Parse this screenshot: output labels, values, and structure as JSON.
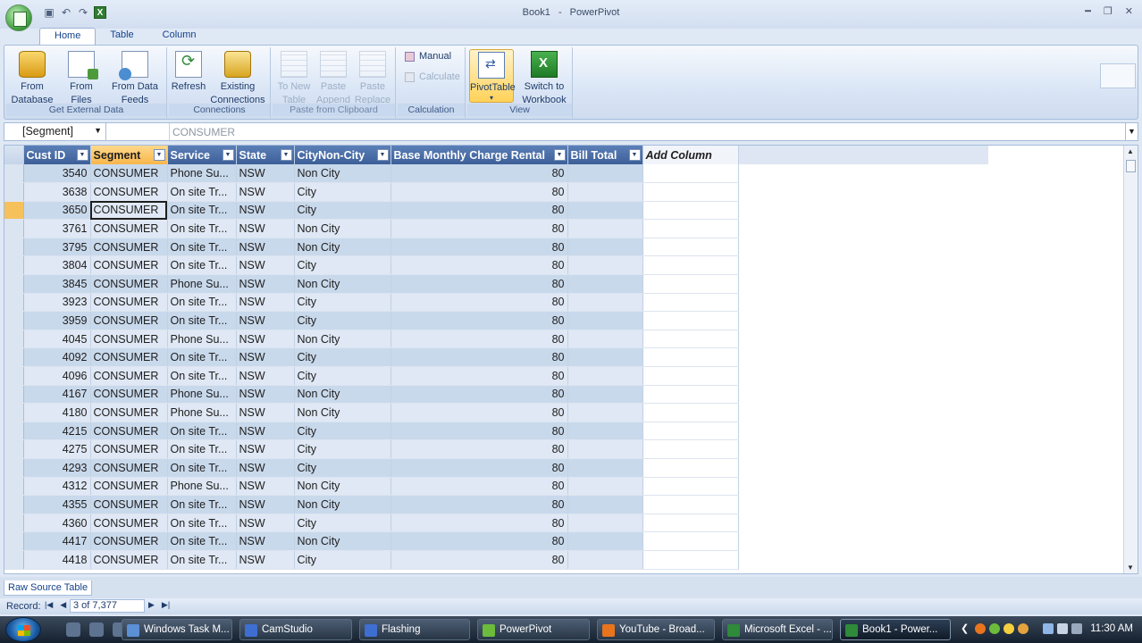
{
  "window": {
    "title": "Book1",
    "app_name": "PowerPivot"
  },
  "ribbon": {
    "tabs": [
      "Home",
      "Table",
      "Column"
    ],
    "active_tab": "Home",
    "groups": {
      "get_external_data": {
        "label": "Get External Data",
        "from_database": [
          "From",
          "Database"
        ],
        "from_files": [
          "From",
          "Files"
        ],
        "from_data_feeds": [
          "From Data",
          "Feeds"
        ]
      },
      "connections": {
        "label": "Connections",
        "refresh": "Refresh",
        "existing_connections": [
          "Existing",
          "Connections"
        ]
      },
      "paste_from_clipboard": {
        "label": "Paste from Clipboard",
        "to_new_table": [
          "To New",
          "Table"
        ],
        "paste_append": [
          "Paste",
          "Append"
        ],
        "paste_replace": [
          "Paste",
          "Replace"
        ]
      },
      "calculation": {
        "label": "Calculation",
        "manual": "Manual",
        "calculate": "Calculate"
      },
      "view": {
        "label": "View",
        "pivot_table": "PivotTable",
        "switch_to_workbook": [
          "Switch to",
          "Workbook"
        ]
      }
    }
  },
  "formula_bar": {
    "name_box": "[Segment]",
    "value": "CONSUMER"
  },
  "grid": {
    "columns": [
      "Cust ID",
      "Segment",
      "Service",
      "State",
      "CityNon-City",
      "Base Monthly Charge Rental",
      "Bill Total"
    ],
    "add_column": "Add Column",
    "selected_column": "Segment",
    "current_row_index": 2,
    "rows": [
      [
        "3540",
        "CONSUMER",
        "Phone Su...",
        "NSW",
        "Non City",
        "80",
        ""
      ],
      [
        "3638",
        "CONSUMER",
        "On site Tr...",
        "NSW",
        "City",
        "80",
        ""
      ],
      [
        "3650",
        "CONSUMER",
        "On site Tr...",
        "NSW",
        "City",
        "80",
        ""
      ],
      [
        "3761",
        "CONSUMER",
        "On site Tr...",
        "NSW",
        "Non City",
        "80",
        ""
      ],
      [
        "3795",
        "CONSUMER",
        "On site Tr...",
        "NSW",
        "Non City",
        "80",
        ""
      ],
      [
        "3804",
        "CONSUMER",
        "On site Tr...",
        "NSW",
        "City",
        "80",
        ""
      ],
      [
        "3845",
        "CONSUMER",
        "Phone Su...",
        "NSW",
        "Non City",
        "80",
        ""
      ],
      [
        "3923",
        "CONSUMER",
        "On site Tr...",
        "NSW",
        "City",
        "80",
        ""
      ],
      [
        "3959",
        "CONSUMER",
        "On site Tr...",
        "NSW",
        "City",
        "80",
        ""
      ],
      [
        "4045",
        "CONSUMER",
        "Phone Su...",
        "NSW",
        "Non City",
        "80",
        ""
      ],
      [
        "4092",
        "CONSUMER",
        "On site Tr...",
        "NSW",
        "City",
        "80",
        ""
      ],
      [
        "4096",
        "CONSUMER",
        "On site Tr...",
        "NSW",
        "City",
        "80",
        ""
      ],
      [
        "4167",
        "CONSUMER",
        "Phone Su...",
        "NSW",
        "Non City",
        "80",
        ""
      ],
      [
        "4180",
        "CONSUMER",
        "Phone Su...",
        "NSW",
        "Non City",
        "80",
        ""
      ],
      [
        "4215",
        "CONSUMER",
        "On site Tr...",
        "NSW",
        "City",
        "80",
        ""
      ],
      [
        "4275",
        "CONSUMER",
        "On site Tr...",
        "NSW",
        "City",
        "80",
        ""
      ],
      [
        "4293",
        "CONSUMER",
        "On site Tr...",
        "NSW",
        "City",
        "80",
        ""
      ],
      [
        "4312",
        "CONSUMER",
        "Phone Su...",
        "NSW",
        "Non City",
        "80",
        ""
      ],
      [
        "4355",
        "CONSUMER",
        "On site Tr...",
        "NSW",
        "Non City",
        "80",
        ""
      ],
      [
        "4360",
        "CONSUMER",
        "On site Tr...",
        "NSW",
        "City",
        "80",
        ""
      ],
      [
        "4417",
        "CONSUMER",
        "On site Tr...",
        "NSW",
        "Non City",
        "80",
        ""
      ],
      [
        "4418",
        "CONSUMER",
        "On site Tr...",
        "NSW",
        "City",
        "80",
        ""
      ]
    ]
  },
  "sheet_tab": "Raw Source Table",
  "status": {
    "record_label": "Record:",
    "record_value": "3 of 7,377"
  },
  "taskbar": {
    "tasks": [
      {
        "label": "Windows Task M...",
        "icon_color": "#5b8fd6"
      },
      {
        "label": "CamStudio",
        "icon_color": "#3f6ed1"
      },
      {
        "label": "Flashing",
        "icon_color": "#3f6ed1"
      },
      {
        "label": "PowerPivot",
        "icon_color": "#6cbb3c"
      },
      {
        "label": "YouTube - Broad...",
        "icon_color": "#e8741e"
      },
      {
        "label": "Microsoft Excel - ...",
        "icon_color": "#2f8a3a"
      },
      {
        "label": "Book1 - Power...",
        "icon_color": "#2f8a3a"
      }
    ],
    "active_task": 6,
    "clock": "11:30 AM"
  },
  "colors": {
    "header_blue": "#4a6ea8",
    "selected_header": "#f7b64c",
    "row_odd": "#c9d9ec",
    "row_even": "#dfe8f4"
  }
}
